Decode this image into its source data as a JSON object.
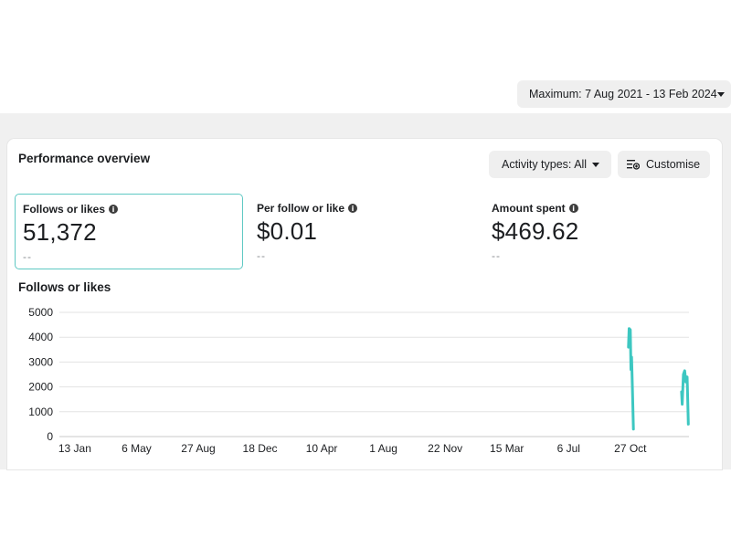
{
  "date_range": {
    "label": "Maximum: 7 Aug 2021 - 13 Feb 2024"
  },
  "card": {
    "title": "Performance overview",
    "activity_button": "Activity types: All",
    "customise_button": "Customise"
  },
  "metrics": [
    {
      "label": "Follows or likes",
      "value": "51,372",
      "delta": "--",
      "selected": true
    },
    {
      "label": "Per follow or like",
      "value": "$0.01",
      "delta": "--",
      "selected": false
    },
    {
      "label": "Amount spent",
      "value": "$469.62",
      "delta": "--",
      "selected": false
    }
  ],
  "chart": {
    "title": "Follows or likes"
  },
  "chart_data": {
    "type": "line",
    "ylim": [
      0,
      5000
    ],
    "yticks": [
      0,
      1000,
      2000,
      3000,
      4000,
      5000
    ],
    "x_tick_labels": [
      "13 Jan",
      "6 May",
      "27 Aug",
      "18 Dec",
      "10 Apr",
      "1 Aug",
      "22 Nov",
      "15 Mar",
      "6 Jul",
      "27 Oct"
    ],
    "x_tick_pos": [
      0,
      1,
      2,
      3,
      4,
      5,
      6,
      7,
      8,
      9
    ],
    "xlim": [
      -0.25,
      9.95
    ],
    "grid": true,
    "color": "#3dc7c1",
    "series": [
      {
        "x": [
          8.97,
          8.98,
          9.0,
          9.01,
          9.02,
          9.035,
          9.05
        ],
        "y": [
          3600,
          4350,
          4300,
          2700,
          3200,
          1800,
          300
        ]
      },
      {
        "x": [
          9.83,
          9.84,
          9.86,
          9.88,
          9.9,
          9.92,
          9.94
        ],
        "y": [
          1800,
          1300,
          2500,
          2650,
          2200,
          2400,
          500
        ]
      }
    ]
  }
}
